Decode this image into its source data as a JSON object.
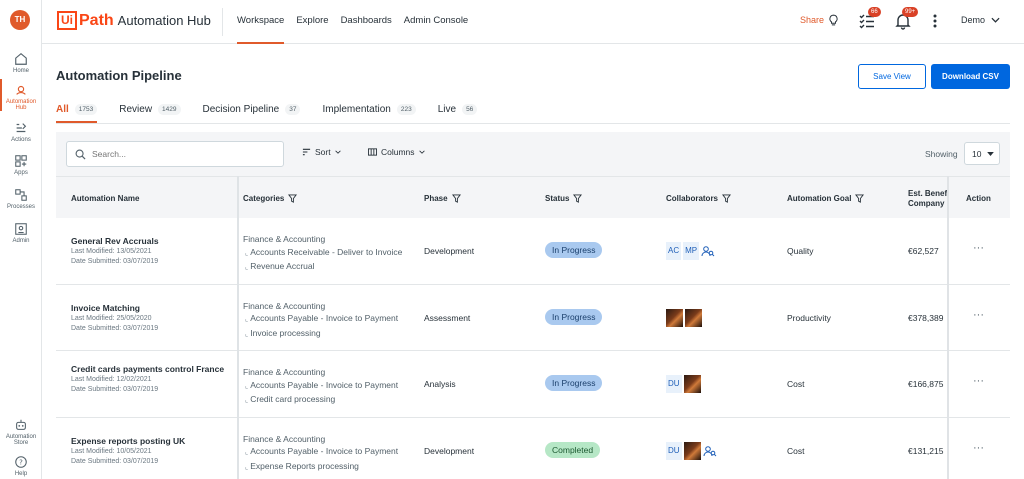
{
  "user": {
    "initials": "TH"
  },
  "rail": {
    "items": [
      {
        "label": "Home"
      },
      {
        "label": "Automation Hub"
      },
      {
        "label": "Actions"
      },
      {
        "label": "Apps"
      },
      {
        "label": "Processes"
      },
      {
        "label": "Admin"
      }
    ],
    "bottom": [
      {
        "label": "Automation Store"
      },
      {
        "label": "Help"
      }
    ]
  },
  "header": {
    "logo_ui": "Ui",
    "logo_path": "Path",
    "product": "Automation Hub",
    "nav": [
      "Workspace",
      "Explore",
      "Dashboards",
      "Admin Console"
    ],
    "share_label": "Share",
    "tasks_badge": "66",
    "notif_badge": "99+",
    "user_name": "Demo"
  },
  "page": {
    "title": "Automation Pipeline",
    "save_view": "Save View",
    "download_csv": "Download CSV"
  },
  "tabs": [
    {
      "label": "All",
      "count": "1753"
    },
    {
      "label": "Review",
      "count": "1429"
    },
    {
      "label": "Decision Pipeline",
      "count": "37"
    },
    {
      "label": "Implementation",
      "count": "223"
    },
    {
      "label": "Live",
      "count": "56"
    }
  ],
  "toolbar": {
    "search_placeholder": "Search...",
    "sort": "Sort",
    "columns": "Columns",
    "showing": "Showing",
    "page_size": "10"
  },
  "table": {
    "headers": {
      "name": "Automation Name",
      "categories": "Categories",
      "phase": "Phase",
      "status": "Status",
      "collaborators": "Collaborators",
      "goal": "Automation Goal",
      "benefit_line1": "Est. Benef",
      "benefit_line2": "Company",
      "action": "Action"
    },
    "rows": [
      {
        "name": "General Rev Accruals",
        "modified": "Last Modified: 13/05/2021",
        "submitted": "Date Submitted: 03/07/2019",
        "cat1": "Finance & Accounting",
        "cat2": "Accounts Receivable - Deliver to Invoice",
        "cat3": "Revenue Accrual",
        "phase": "Development",
        "status": "In Progress",
        "collab_a": "AC",
        "collab_b": "MP",
        "goal": "Quality",
        "benefit": "€62,527",
        "action": "···"
      },
      {
        "name": "Invoice Matching",
        "modified": "Last Modified: 25/05/2020",
        "submitted": "Date Submitted: 03/07/2019",
        "cat1": "Finance & Accounting",
        "cat2": "Accounts Payable - Invoice to Payment",
        "cat3": "Invoice processing",
        "phase": "Assessment",
        "status": "In Progress",
        "goal": "Productivity",
        "benefit": "€378,389",
        "action": "···"
      },
      {
        "name": "Credit cards payments control France",
        "modified": "Last Modified: 12/02/2021",
        "submitted": "Date Submitted: 03/07/2019",
        "cat1": "Finance & Accounting",
        "cat2": "Accounts Payable - Invoice to Payment",
        "cat3": "Credit card processing",
        "phase": "Analysis",
        "status": "In Progress",
        "collab_a": "DU",
        "goal": "Cost",
        "benefit": "€166,875",
        "action": "···"
      },
      {
        "name": "Expense reports posting UK",
        "modified": "Last Modified: 10/05/2021",
        "submitted": "Date Submitted: 03/07/2019",
        "cat1": "Finance & Accounting",
        "cat2": "Accounts Payable - Invoice to Payment",
        "cat3": "Expense Reports processing",
        "phase": "Development",
        "status": "Completed",
        "collab_a": "DU",
        "goal": "Cost",
        "benefit": "€131,215",
        "action": "···"
      }
    ]
  },
  "colors": {
    "accent": "#e05a2b",
    "primary": "#0067df",
    "in_progress": "#a9c9ef",
    "completed": "#b6e7c6"
  }
}
